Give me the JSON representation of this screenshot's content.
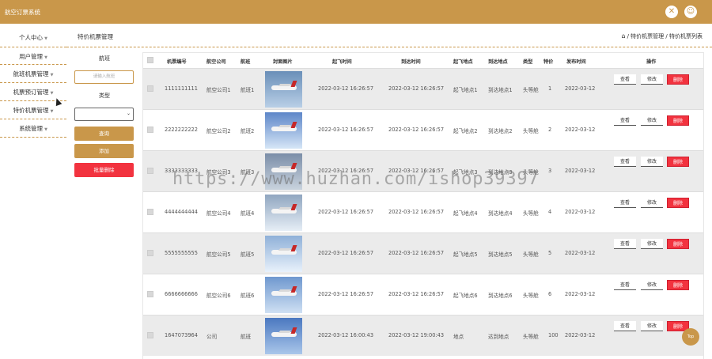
{
  "app": {
    "title": "航空订票系统"
  },
  "topbar": {
    "icons": [
      "tools-icon",
      "user-avatar-icon"
    ]
  },
  "sidebar": {
    "items": [
      {
        "label": "个人中心"
      },
      {
        "label": "用户管理"
      },
      {
        "label": "航班机票管理"
      },
      {
        "label": "机票预订管理"
      },
      {
        "label": "特价机票管理"
      },
      {
        "label": "系统管理"
      }
    ]
  },
  "header": {
    "page_title": "特价机票管理",
    "breadcrumb": "/ 特价机票管理 / 特价机票列表"
  },
  "filter": {
    "flight_label": "航班",
    "flight_placeholder": "请输入航班",
    "type_label": "类型",
    "query_button": "查询",
    "add_button": "添加",
    "batch_delete_button": "批量删除"
  },
  "table": {
    "headers": [
      "机票编号",
      "航空公司",
      "航班",
      "封面图片",
      "起飞时间",
      "到达时间",
      "起飞地点",
      "到达地点",
      "类型",
      "特价",
      "发布时间",
      "操作"
    ],
    "actions": {
      "view": "查看",
      "edit": "修改",
      "delete": "删除"
    },
    "rows": [
      {
        "ticket_no": "1111111111",
        "airline": "航空公司1",
        "flight": "航班1",
        "depart": "2022-03-12 16:26:57",
        "arrive": "2022-03-12 16:26:57",
        "from": "起飞地点1",
        "to": "到达地点1",
        "type": "头等舱",
        "price": "1",
        "published": "2022-03-12"
      },
      {
        "ticket_no": "2222222222",
        "airline": "航空公司2",
        "flight": "航班2",
        "depart": "2022-03-12 16:26:57",
        "arrive": "2022-03-12 16:26:57",
        "from": "起飞地点2",
        "to": "到达地点2",
        "type": "头等舱",
        "price": "2",
        "published": "2022-03-12"
      },
      {
        "ticket_no": "3333333333",
        "airline": "航空公司3",
        "flight": "航班3",
        "depart": "2022-03-12 16:26:57",
        "arrive": "2022-03-12 16:26:57",
        "from": "起飞地点3",
        "to": "到达地点3",
        "type": "头等舱",
        "price": "3",
        "published": "2022-03-12"
      },
      {
        "ticket_no": "4444444444",
        "airline": "航空公司4",
        "flight": "航班4",
        "depart": "2022-03-12 16:26:57",
        "arrive": "2022-03-12 16:26:57",
        "from": "起飞地点4",
        "to": "到达地点4",
        "type": "头等舱",
        "price": "4",
        "published": "2022-03-12"
      },
      {
        "ticket_no": "5555555555",
        "airline": "航空公司5",
        "flight": "航班5",
        "depart": "2022-03-12 16:26:57",
        "arrive": "2022-03-12 16:26:57",
        "from": "起飞地点5",
        "to": "到达地点5",
        "type": "头等舱",
        "price": "5",
        "published": "2022-03-12"
      },
      {
        "ticket_no": "6666666666",
        "airline": "航空公司6",
        "flight": "航班6",
        "depart": "2022-03-12 16:26:57",
        "arrive": "2022-03-12 16:26:57",
        "from": "起飞地点6",
        "to": "到达地点6",
        "type": "头等舱",
        "price": "6",
        "published": "2022-03-12"
      },
      {
        "ticket_no": "1647073964",
        "airline": "公司",
        "flight": "航班",
        "depart": "2022-03-12 16:00:43",
        "arrive": "2022-03-12 19:00:43",
        "from": "地点",
        "to": "达到地点",
        "type": "头等舱",
        "price": "100",
        "published": "2022-03-12"
      }
    ]
  },
  "top_button": "Top",
  "watermark": "https://www.huzhan.com/ishop39397",
  "colors": {
    "brand": "#c9974a",
    "danger": "#f2333f",
    "row_alt": "#ebebeb"
  }
}
